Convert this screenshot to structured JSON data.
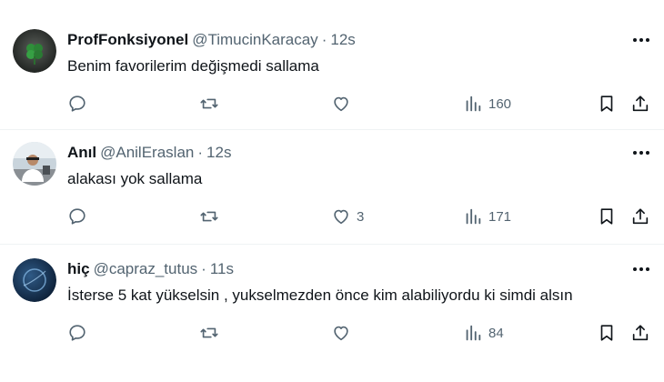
{
  "tweets": [
    {
      "name": "ProfFonksiyonel",
      "handle": "@TimucinKaracay",
      "separator": "·",
      "time": "12s",
      "text": "Benim favorilerim değişmedi sallama",
      "likes": "",
      "views": "160",
      "avatar_icon": "clover-avatar"
    },
    {
      "name": "Anıl",
      "handle": "@AnilEraslan",
      "separator": "·",
      "time": "12s",
      "text": "alakası yok sallama",
      "likes": "3",
      "views": "171",
      "avatar_icon": "person-in-car-avatar"
    },
    {
      "name": "hiç",
      "handle": "@capraz_tutus",
      "separator": "·",
      "time": "11s",
      "text": "İsterse 5 kat yükselsin , yukselmezden önce kim alabiliyordu ki simdi alsın",
      "likes": "",
      "views": "84",
      "avatar_icon": "planet-avatar"
    }
  ],
  "colors": {
    "text_primary": "#0f1419",
    "text_secondary": "#536471",
    "divider": "#eff3f4"
  }
}
